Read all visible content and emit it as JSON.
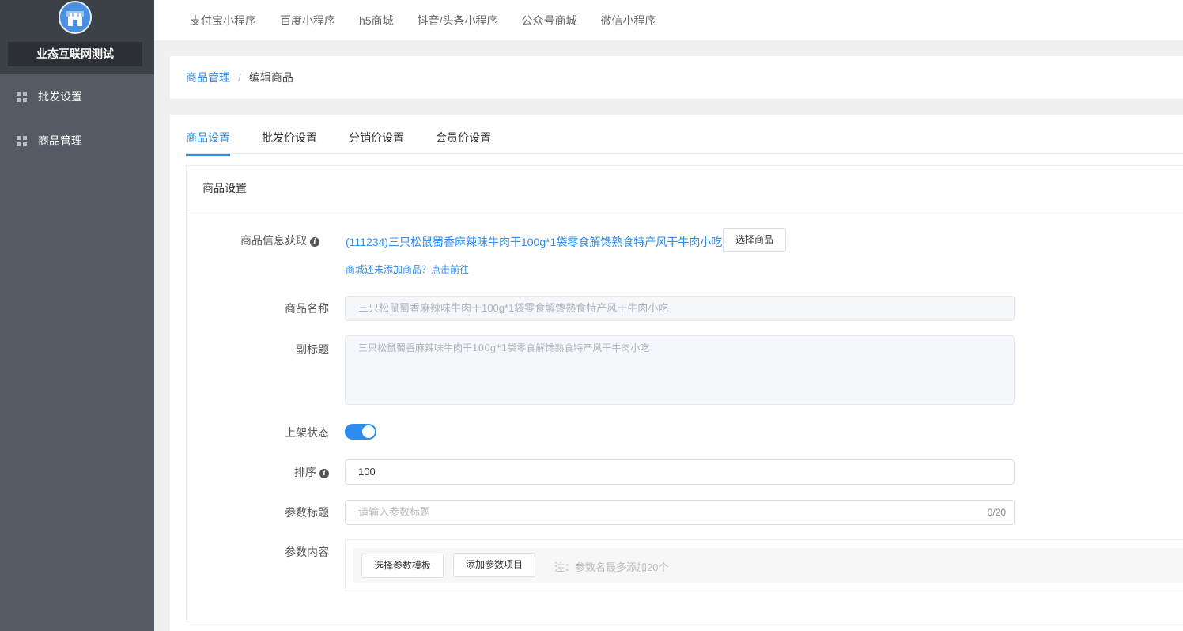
{
  "sidebar": {
    "store_name": "业态互联网测试",
    "items": [
      {
        "label": "批发设置"
      },
      {
        "label": "商品管理"
      }
    ]
  },
  "topbar": {
    "tabs": [
      "支付宝小程序",
      "百度小程序",
      "h5商城",
      "抖音/头条小程序",
      "公众号商城",
      "微信小程序"
    ]
  },
  "breadcrumb": {
    "parent": "商品管理",
    "separator": "/",
    "current": "编辑商品"
  },
  "tabs": [
    "商品设置",
    "批发价设置",
    "分销价设置",
    "会员价设置"
  ],
  "panel": {
    "title": "商品设置",
    "product_source": {
      "label": "商品信息获取",
      "info_icon": "i",
      "product_text": "(111234)三只松鼠蜀香麻辣味牛肉干100g*1袋零食解馋熟食特产风干牛肉小吃",
      "select_button": "选择商品",
      "hint_link": "商城还未添加商品？点击前往"
    },
    "name": {
      "label": "商品名称",
      "value": "三只松鼠蜀香麻辣味牛肉干100g*1袋零食解馋熟食特产风干牛肉小吃"
    },
    "subtitle": {
      "label": "副标题",
      "value": "三只松鼠蜀香麻辣味牛肉干100g*1袋零食解馋熟食特产风干牛肉小吃"
    },
    "status": {
      "label": "上架状态",
      "enabled": true
    },
    "sort": {
      "label": "排序",
      "info_icon": "i",
      "value": "100"
    },
    "param_title": {
      "label": "参数标题",
      "placeholder": "请输入参数标题",
      "counter": "0/20"
    },
    "param_content": {
      "label": "参数内容",
      "template_button": "选择参数模板",
      "add_button": "添加参数项目",
      "note": "注：参数名最多添加20个"
    }
  },
  "colors": {
    "primary": "#2d8cf0",
    "sidebar_bg": "#555b63",
    "sidebar_top_bg": "#3c4047"
  },
  "icons": [
    "store-avatar-icon",
    "grid-icon",
    "info-icon"
  ]
}
